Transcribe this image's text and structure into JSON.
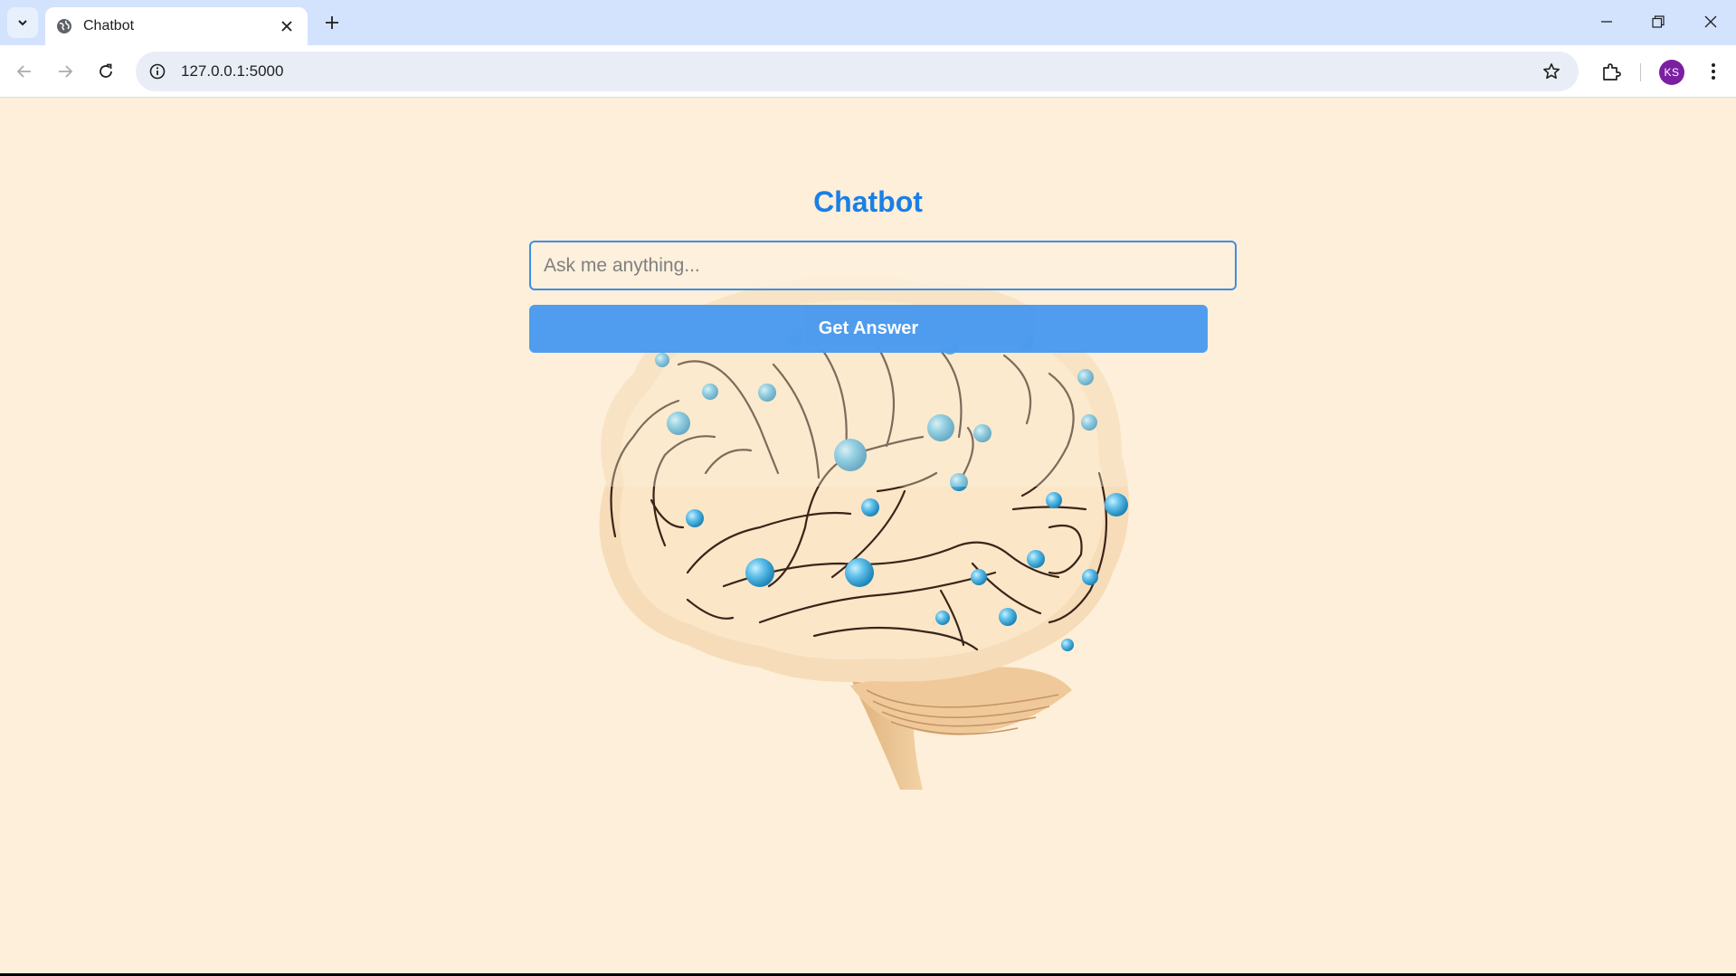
{
  "browser": {
    "tab_title": "Chatbot",
    "url": "127.0.0.1:5000",
    "profile_initials": "KS",
    "avatar_color": "#7b1fa2",
    "icons": [
      "tab-search-icon",
      "globe-icon",
      "close-icon",
      "plus-icon",
      "minimize-icon",
      "restore-icon",
      "window-close-icon",
      "back-arrow-icon",
      "forward-arrow-icon",
      "reload-icon",
      "site-info-icon",
      "star-icon",
      "puzzle-icon",
      "kebab-menu-icon"
    ]
  },
  "page": {
    "title": "Chatbot",
    "title_color": "#1a7fe6",
    "input_placeholder": "Ask me anything...",
    "input_value": "",
    "button_label": "Get Answer",
    "button_color": "#4a9af0",
    "background_color": "#fdefd9",
    "background_image": "brain-network-illustration"
  }
}
